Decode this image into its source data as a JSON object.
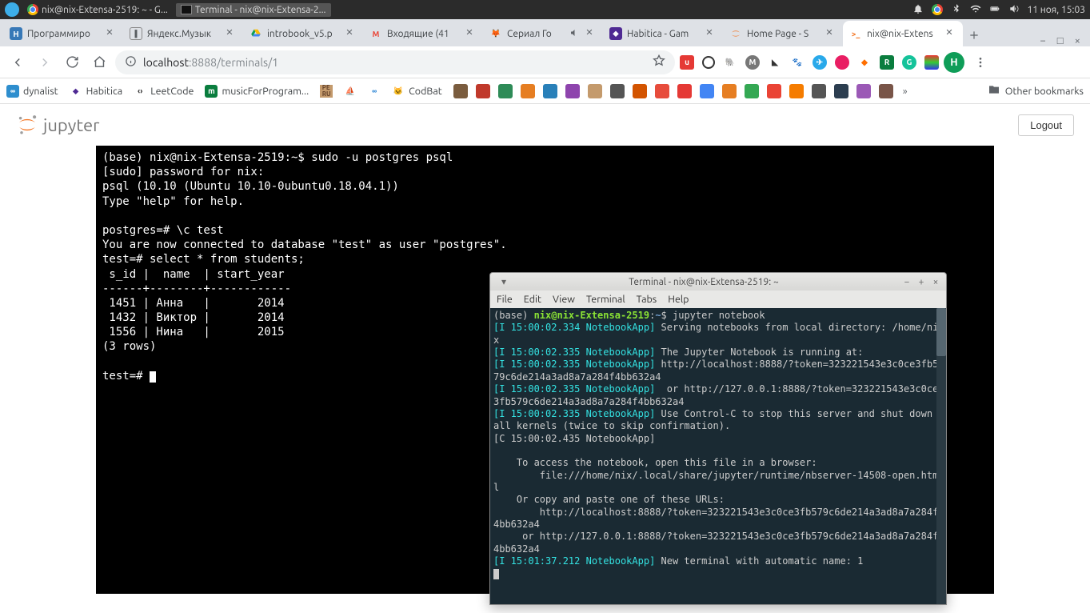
{
  "os": {
    "task1": "nix@nix-Extensa-2519: ~ - G...",
    "task2": "Terminal - nix@nix-Extensa-2...",
    "clock": "11 ноя, 15:03"
  },
  "tabs": [
    {
      "title": "Программиро",
      "fav": "H",
      "favbg": "#3778b7"
    },
    {
      "title": "Яндекс.Музык",
      "fav": "pause"
    },
    {
      "title": "introbook_v5.p",
      "fav": "drive"
    },
    {
      "title": "Входящие (41",
      "fav": "gmail"
    },
    {
      "title": "Сериал Го",
      "fav": "fox",
      "audio": true
    },
    {
      "title": "Habitica - Gam",
      "fav": "habitica"
    },
    {
      "title": "Home Page - S",
      "fav": "jupyter"
    },
    {
      "title": "nix@nix-Extens",
      "fav": "jterm",
      "active": true
    }
  ],
  "url": {
    "host": "localhost",
    "port": ":8888",
    "path": "/terminals/1"
  },
  "bookmarks": [
    {
      "label": "dynalist",
      "fav": "dyn"
    },
    {
      "label": "Habitica",
      "fav": "hab"
    },
    {
      "label": "LeetCode",
      "fav": "leet"
    },
    {
      "label": "musicForProgram...",
      "fav": "mfp"
    },
    {
      "label": "",
      "fav": "pe"
    },
    {
      "label": "",
      "fav": "boat"
    },
    {
      "label": "",
      "fav": "loop"
    },
    {
      "label": "CodBat",
      "fav": "cat"
    }
  ],
  "other_bookmarks": "Other bookmarks",
  "logout": "Logout",
  "profile_letter": "Н",
  "terminal_lines": [
    "(base) nix@nix-Extensa-2519:~$ sudo -u postgres psql",
    "[sudo] password for nix:",
    "psql (10.10 (Ubuntu 10.10-0ubuntu0.18.04.1))",
    "Type \"help\" for help.",
    "",
    "postgres=# \\c test",
    "You are now connected to database \"test\" as user \"postgres\".",
    "test=# select * from students;",
    " s_id |  name  | start_year",
    "------+--------+------------",
    " 1451 | Анна   |       2014",
    " 1432 | Виктор |       2014",
    " 1556 | Нина   |       2015",
    "(3 rows)",
    "",
    "test=# "
  ],
  "termwin": {
    "title": "Terminal - nix@nix-Extensa-2519: ~",
    "menus": [
      "File",
      "Edit",
      "View",
      "Terminal",
      "Tabs",
      "Help"
    ],
    "prompt_user": "nix@nix-Extensa-2519",
    "prompt_path": "~",
    "prompt_cmd": "jupyter notebook",
    "base": "(base) ",
    "lines": [
      {
        "tag": "[I 15:00:02.334 NotebookApp]",
        "msg": " Serving notebooks from local directory: /home/nix"
      },
      {
        "tag": "[I 15:00:02.335 NotebookApp]",
        "msg": " The Jupyter Notebook is running at:"
      },
      {
        "tag": "[I 15:00:02.335 NotebookApp]",
        "msg": " http://localhost:8888/?token=323221543e3c0ce3fb579c6de214a3ad8a7a284f4bb632a4"
      },
      {
        "tag": "[I 15:00:02.335 NotebookApp]",
        "msg": "  or http://127.0.0.1:8888/?token=323221543e3c0ce3fb579c6de214a3ad8a7a284f4bb632a4"
      },
      {
        "tag": "[I 15:00:02.335 NotebookApp]",
        "msg": " Use Control-C to stop this server and shut down all kernels (twice to skip confirmation)."
      },
      {
        "plain": "[C 15:00:02.435 NotebookApp]"
      },
      {
        "plain": ""
      },
      {
        "plain": "    To access the notebook, open this file in a browser:"
      },
      {
        "plain": "        file:///home/nix/.local/share/jupyter/runtime/nbserver-14508-open.html"
      },
      {
        "plain": "    Or copy and paste one of these URLs:"
      },
      {
        "plain": "        http://localhost:8888/?token=323221543e3c0ce3fb579c6de214a3ad8a7a284f4bb632a4"
      },
      {
        "plain": "     or http://127.0.0.1:8888/?token=323221543e3c0ce3fb579c6de214a3ad8a7a284f4bb632a4"
      },
      {
        "tag": "[I 15:01:37.212 NotebookApp]",
        "msg": " New terminal with automatic name: 1"
      }
    ]
  }
}
